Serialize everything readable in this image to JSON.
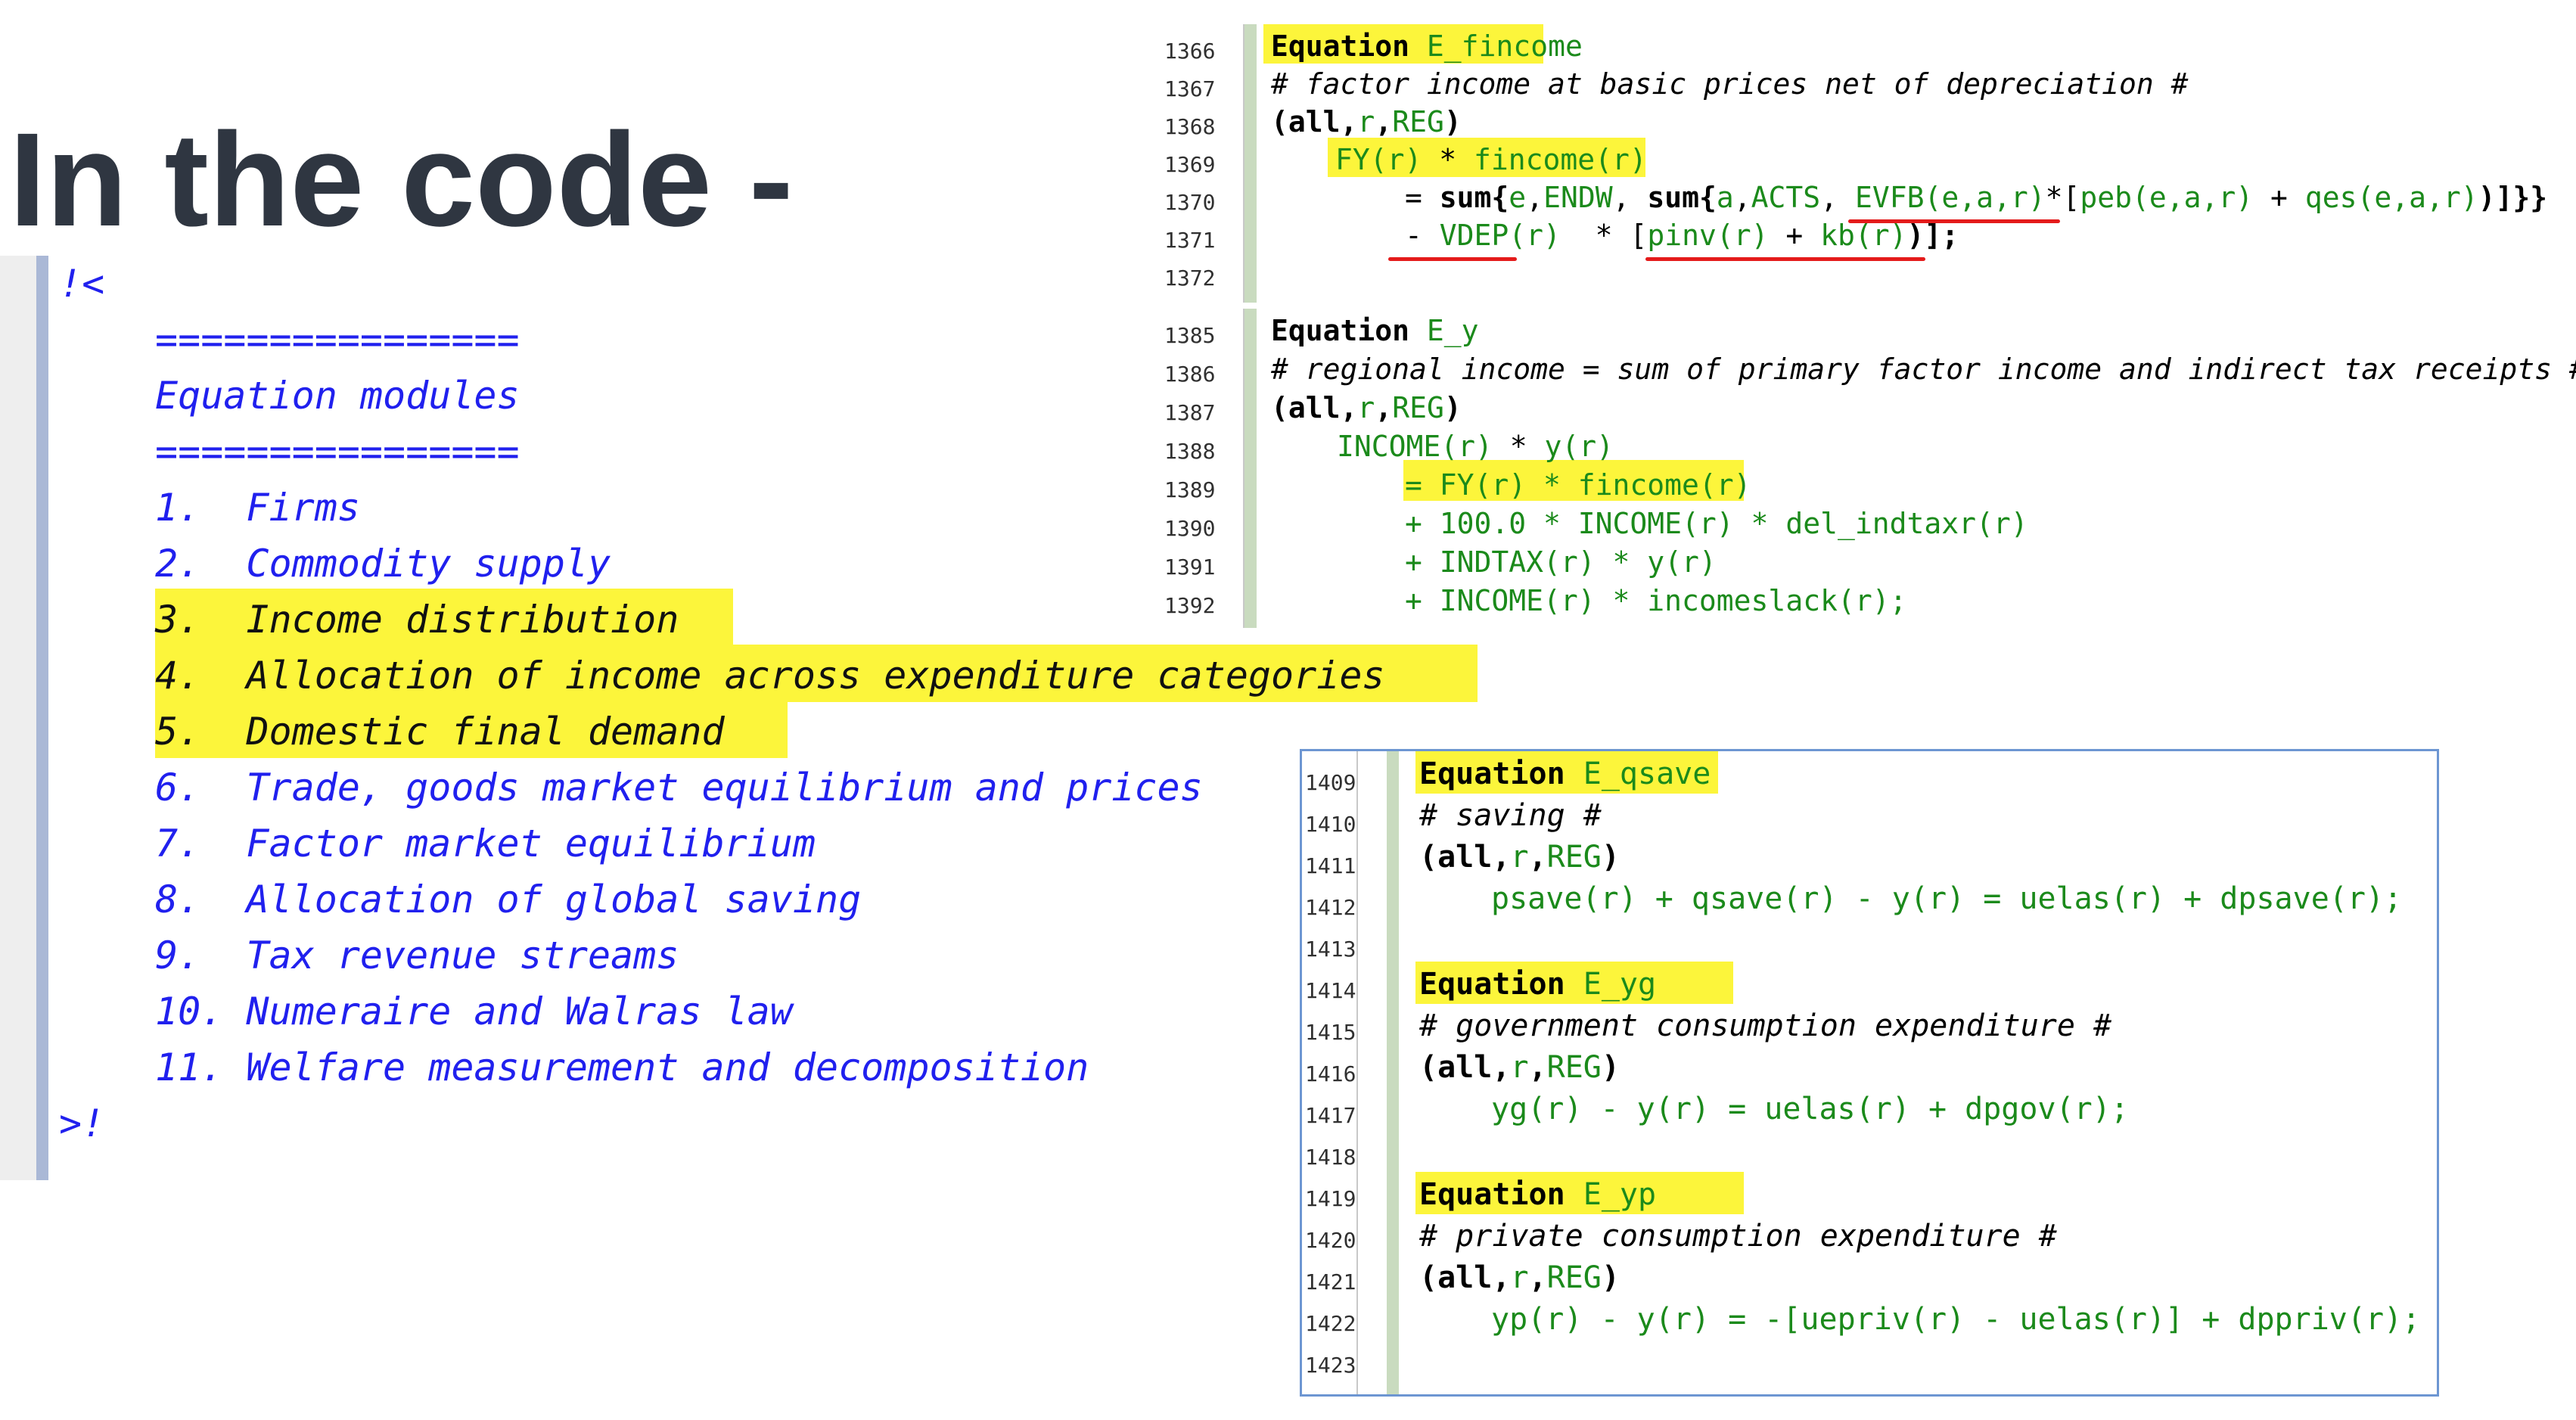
{
  "slide": {
    "title": "In the code -"
  },
  "modules": {
    "open": "!<",
    "rule": "================",
    "heading": "Equation modules",
    "items": [
      "1.  Firms",
      "2.  Commodity supply",
      "3.  Income distribution",
      "4.  Allocation of income across expenditure categories",
      "5.  Domestic final demand",
      "6.  Trade, goods market equilibrium and prices",
      "7.  Factor market equilibrium",
      "8.  Allocation of global saving",
      "9.  Tax revenue streams",
      "10. Numeraire and Walras law",
      "11. Welfare measurement and decomposition"
    ],
    "highlighted_items": [
      3,
      4,
      5
    ],
    "close": ">!"
  },
  "colors": {
    "highlight": "#fcf53b",
    "keyword": "#000000",
    "identifier": "#1b8a1b",
    "comment_text": "#2020ee",
    "underline": "#e41b1b",
    "title": "#2f3641",
    "panel_border": "#6d96d2"
  },
  "panel_fincome": {
    "line_numbers": [
      "1366",
      "1367",
      "1368",
      "1369",
      "1370",
      "1371",
      "1372"
    ],
    "lines": [
      {
        "kw": "Equation",
        "name": "E_fincome"
      },
      {
        "comment": "# factor income at basic prices net of depreciation #"
      },
      {
        "open": "(",
        "all": "all",
        "sep1": ",",
        "r": "r",
        "sep2": ",",
        "reg": "REG",
        "close": ")"
      },
      {
        "a": "FY(r)",
        "b": " * ",
        "c": "fincome(r)"
      },
      {
        "eq": "= ",
        "sum1": "sum",
        "p1": "{",
        "e": "e",
        "s1": ",",
        "endw": "ENDW",
        "s2": ", ",
        "sum2": "sum",
        "p2": "{",
        "a": "a",
        "s3": ",",
        "acts": "ACTS",
        "s4": ", ",
        "evfb": "EVFB(e,a,r)",
        "s5": "*[",
        "peb": "peb(e,a,r)",
        "plus": " + ",
        "qes": "qes(e,a,r)",
        "end": ")]}}"
      },
      {
        "minus": "- ",
        "vdep": "VDEP(r)",
        "mid": "  * [",
        "pinv": "pinv(r)",
        "plus": " + ",
        "kb": "kb(r)",
        "end": ")];"
      }
    ]
  },
  "panel_y": {
    "line_numbers": [
      "1385",
      "1386",
      "1387",
      "1388",
      "1389",
      "1390",
      "1391",
      "1392"
    ],
    "lines": [
      {
        "kw": "Equation",
        "name": "E_y"
      },
      {
        "comment": "# regional income = sum of primary factor income and indirect tax receipts #"
      },
      {
        "open": "(",
        "all": "all",
        "sep1": ",",
        "r": "r",
        "sep2": ",",
        "reg": "REG",
        "close": ")"
      },
      {
        "a": "INCOME(r)",
        "b": " * ",
        "c": "y(r)"
      },
      {
        "a": "= FY(r) * fincome(r)"
      },
      {
        "a": "+ 100.0 * INCOME(r) * del_indtaxr(r)"
      },
      {
        "a": "+ INDTAX(r) * y(r)"
      },
      {
        "a": "+ INCOME(r) * incomeslack(r);"
      }
    ]
  },
  "panel_save": {
    "line_numbers": [
      "1409",
      "1410",
      "1411",
      "1412",
      "1413",
      "1414",
      "1415",
      "1416",
      "1417",
      "1418",
      "1419",
      "1420",
      "1421",
      "1422",
      "1423"
    ],
    "lines": [
      {
        "kw": "Equation",
        "name": "E_qsave"
      },
      {
        "comment": "# saving #"
      },
      {
        "open": "(",
        "all": "all",
        "sep1": ",",
        "r": "r",
        "sep2": ",",
        "reg": "REG",
        "close": ")"
      },
      {
        "a": "psave(r) + qsave(r) - y(r) = uelas(r) + dpsave(r);"
      },
      {
        "kw": "Equation",
        "name": "E_yg"
      },
      {
        "comment": "# government consumption expenditure #"
      },
      {
        "open": "(",
        "all": "all",
        "sep1": ",",
        "r": "r",
        "sep2": ",",
        "reg": "REG",
        "close": ")"
      },
      {
        "a": "yg(r) - y(r) = uelas(r) + dpgov(r);"
      },
      {
        "kw": "Equation",
        "name": "E_yp"
      },
      {
        "comment": "# private consumption expenditure #"
      },
      {
        "open": "(",
        "all": "all",
        "sep1": ",",
        "r": "r",
        "sep2": ",",
        "reg": "REG",
        "close": ")"
      },
      {
        "a": "yp(r) - y(r) = -[",
        "b": "uepriv(r) - uelas(r)",
        "c": "] + dppriv(r);"
      }
    ]
  }
}
